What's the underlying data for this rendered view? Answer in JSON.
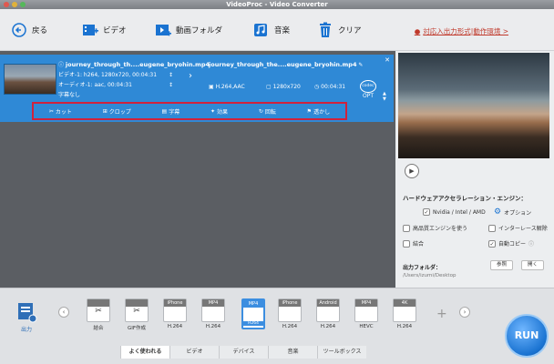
{
  "window": {
    "title": "VideoProc - Video Converter"
  },
  "toolbar": {
    "back": "戻る",
    "video": "ビデオ",
    "folder": "動画フォルダ",
    "music": "音楽",
    "clear": "クリア",
    "support_link": "対応入出力形式|動作環境 >"
  },
  "video": {
    "source_name": "journey_through_th....eugene_bryohin.mp4",
    "video_info": "ビデオ-1: h264, 1280x720, 00:04:31",
    "audio_info": "オーディオ-1: aac, 00:04:31",
    "subtitle": "字幕なし",
    "output_name": "journey_through_the....eugene_bryohin.mp4",
    "output_codec": "H.264,AAC",
    "output_res": "1280x720",
    "output_duration": "00:04:31",
    "codec_label": "codec",
    "opt_label": "OPT"
  },
  "edit": {
    "cut": "カット",
    "crop": "クロップ",
    "subtitle": "字幕",
    "effect": "効果",
    "rotate": "回転",
    "watermark": "透かし"
  },
  "hw": {
    "title": "ハードウェアアクセラレーション・エンジン：",
    "nvidia": "Nvidia / Intel / AMD",
    "option": "オプション",
    "hq": "高品質エンジンを使う",
    "deinterlace": "インターレース解除",
    "merge": "結合",
    "autocopy": "自動コピー",
    "output_folder": "出力フォルダ：",
    "path": "/Users/izumi/Desktop",
    "browse": "参照",
    "open": "開く"
  },
  "formats": [
    {
      "name": "結合",
      "header": "",
      "sub": ""
    },
    {
      "name": "GIF作成",
      "header": "",
      "sub": ""
    },
    {
      "name": "H.264",
      "header": "iPhone",
      "sub": ""
    },
    {
      "name": "H.264",
      "header": "MP4",
      "sub": ""
    },
    {
      "name": "",
      "header": "MP4",
      "sub": "H264"
    },
    {
      "name": "H.264",
      "header": "iPhone",
      "sub": ""
    },
    {
      "name": "H.264",
      "header": "Android",
      "sub": ""
    },
    {
      "name": "HEVC",
      "header": "MP4",
      "sub": ""
    },
    {
      "name": "H.264",
      "header": "4K",
      "sub": ""
    }
  ],
  "bottom": {
    "output_label": "出力",
    "tabs": [
      "よく使われる",
      "ビデオ",
      "デバイス",
      "音楽",
      "ツールボックス"
    ],
    "run": "RUN"
  },
  "colors": {
    "accent": "#2f89d6",
    "highlight": "#d0223c",
    "run": "#1a73d1"
  }
}
